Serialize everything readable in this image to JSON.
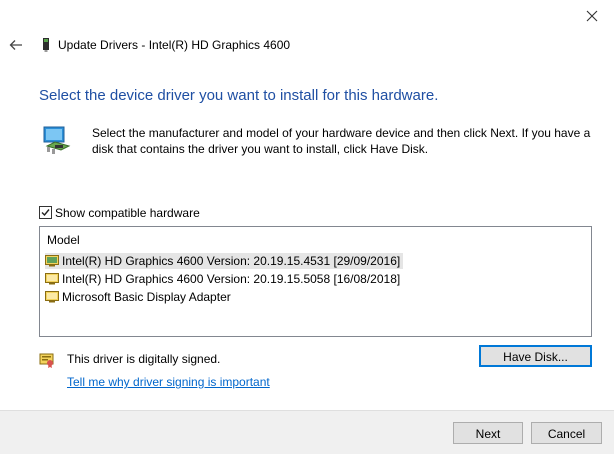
{
  "window": {
    "title": "Update Drivers - Intel(R) HD Graphics 4600"
  },
  "heading": "Select the device driver you want to install for this hardware.",
  "description": "Select the manufacturer and model of your hardware device and then click Next. If you have a disk that contains the driver you want to install, click Have Disk.",
  "compatible": {
    "label": "Show compatible hardware",
    "checked": true
  },
  "model_list": {
    "header": "Model",
    "items": [
      {
        "label": "Intel(R) HD Graphics 4600 Version: 20.19.15.4531 [29/09/2016]",
        "selected": true,
        "icon": "monitor-green-icon"
      },
      {
        "label": "Intel(R) HD Graphics 4600 Version: 20.19.15.5058 [16/08/2018]",
        "selected": false,
        "icon": "monitor-yellow-icon"
      },
      {
        "label": "Microsoft Basic Display Adapter",
        "selected": false,
        "icon": "monitor-yellow-icon"
      }
    ]
  },
  "signing": {
    "status": "This driver is digitally signed.",
    "link": "Tell me why driver signing is important"
  },
  "buttons": {
    "have_disk": "Have Disk...",
    "next": "Next",
    "cancel": "Cancel"
  }
}
